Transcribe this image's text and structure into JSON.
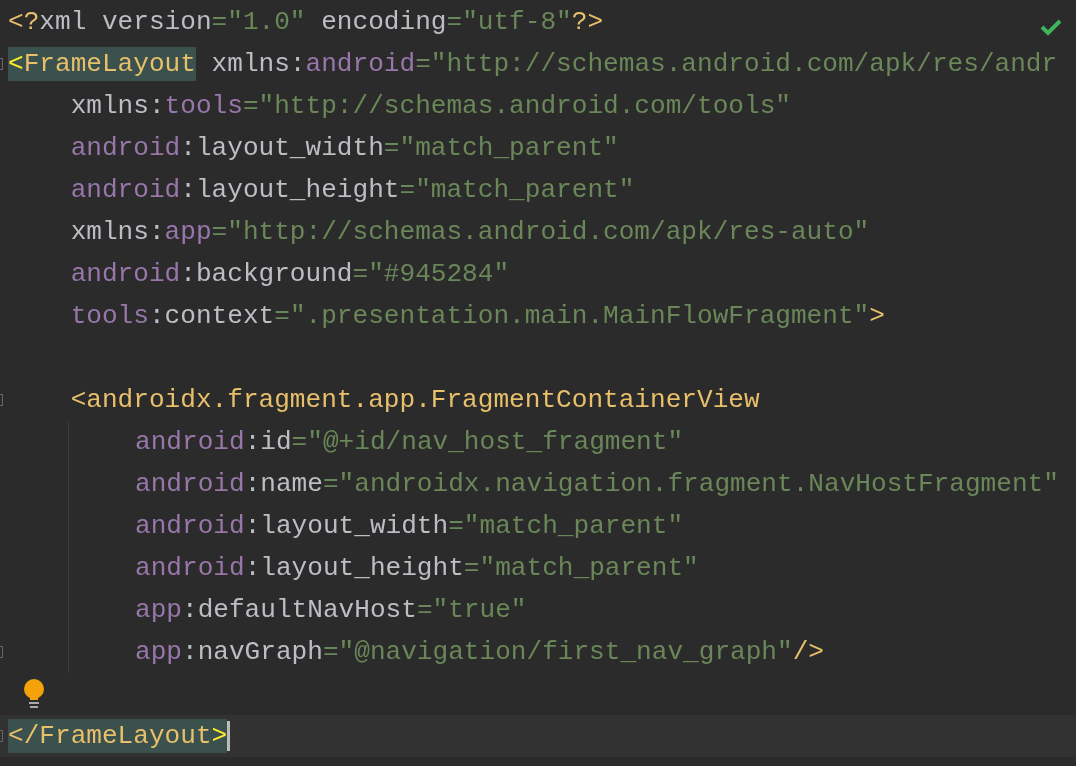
{
  "editor": {
    "inspection_ok": true,
    "lines": [
      {
        "tokens": [
          {
            "kind": "prolog",
            "text": "<?"
          },
          {
            "kind": "text",
            "text": "xml version"
          },
          {
            "kind": "value",
            "text": "=\"1.0\""
          },
          {
            "kind": "text",
            "text": " encoding"
          },
          {
            "kind": "value",
            "text": "=\"utf-8\""
          },
          {
            "kind": "prolog",
            "text": "?>"
          }
        ]
      },
      {
        "fold": true,
        "tokens": [
          {
            "kind": "bracket",
            "text": "<",
            "matched": true
          },
          {
            "kind": "tag",
            "text": "FrameLayout",
            "matched": true
          },
          {
            "kind": "text",
            "text": " xmlns:"
          },
          {
            "kind": "namespace",
            "text": "android"
          },
          {
            "kind": "value",
            "text": "=\"http://schemas.android.com/apk/res/andr"
          }
        ]
      },
      {
        "tokens": [
          {
            "kind": "text",
            "text": "    xmlns:"
          },
          {
            "kind": "namespace",
            "text": "tools"
          },
          {
            "kind": "value",
            "text": "=\"http://schemas.android.com/tools\""
          }
        ]
      },
      {
        "tokens": [
          {
            "kind": "namespace",
            "text": "    android"
          },
          {
            "kind": "text",
            "text": ":layout_width"
          },
          {
            "kind": "value",
            "text": "=\"match_parent\""
          }
        ]
      },
      {
        "tokens": [
          {
            "kind": "namespace",
            "text": "    android"
          },
          {
            "kind": "text",
            "text": ":layout_height"
          },
          {
            "kind": "value",
            "text": "=\"match_parent\""
          }
        ]
      },
      {
        "tokens": [
          {
            "kind": "text",
            "text": "    xmlns:"
          },
          {
            "kind": "namespace",
            "text": "app"
          },
          {
            "kind": "value",
            "text": "=\"http://schemas.android.com/apk/res-auto\""
          }
        ]
      },
      {
        "tokens": [
          {
            "kind": "namespace",
            "text": "    android"
          },
          {
            "kind": "text",
            "text": ":background"
          },
          {
            "kind": "value",
            "text": "=\"#945284\""
          }
        ]
      },
      {
        "tokens": [
          {
            "kind": "namespace",
            "text": "    tools"
          },
          {
            "kind": "text",
            "text": ":context"
          },
          {
            "kind": "value",
            "text": "=\".presentation.main.MainFlowFragment\""
          },
          {
            "kind": "tag",
            "text": ">"
          }
        ]
      },
      {
        "bulb": false
      },
      {
        "fold": true,
        "tokens": [
          {
            "kind": "tag",
            "text": "    <androidx.fragment.app.FragmentContainerView"
          }
        ],
        "children": [
          {
            "tokens": [
              {
                "kind": "namespace",
                "text": "android"
              },
              {
                "kind": "text",
                "text": ":id"
              },
              {
                "kind": "value",
                "text": "=\"@+id/nav_host_fragment\""
              }
            ]
          },
          {
            "tokens": [
              {
                "kind": "namespace",
                "text": "android"
              },
              {
                "kind": "text",
                "text": ":name"
              },
              {
                "kind": "value",
                "text": "=\"androidx.navigation.fragment.NavHostFragment\""
              }
            ]
          },
          {
            "tokens": [
              {
                "kind": "namespace",
                "text": "android"
              },
              {
                "kind": "text",
                "text": ":layout_width"
              },
              {
                "kind": "value",
                "text": "=\"match_parent\""
              }
            ]
          },
          {
            "tokens": [
              {
                "kind": "namespace",
                "text": "android"
              },
              {
                "kind": "text",
                "text": ":layout_height"
              },
              {
                "kind": "value",
                "text": "=\"match_parent\""
              }
            ]
          },
          {
            "tokens": [
              {
                "kind": "namespace",
                "text": "app"
              },
              {
                "kind": "text",
                "text": ":defaultNavHost"
              },
              {
                "kind": "value",
                "text": "=\"true\""
              }
            ]
          },
          {
            "fold": true,
            "tokens": [
              {
                "kind": "namespace",
                "text": "app"
              },
              {
                "kind": "text",
                "text": ":navGraph"
              },
              {
                "kind": "value",
                "text": "=\"@navigation/first_nav_graph\""
              },
              {
                "kind": "tag",
                "text": "/>"
              }
            ]
          }
        ]
      },
      {
        "bulb": true
      },
      {
        "fold": true,
        "current": true,
        "tokens": [
          {
            "kind": "tag",
            "text": "</",
            "matched": true
          },
          {
            "kind": "tag",
            "text": "FrameLayout",
            "matched": true
          },
          {
            "kind": "bracket",
            "text": ">",
            "matched": true
          }
        ]
      }
    ]
  }
}
